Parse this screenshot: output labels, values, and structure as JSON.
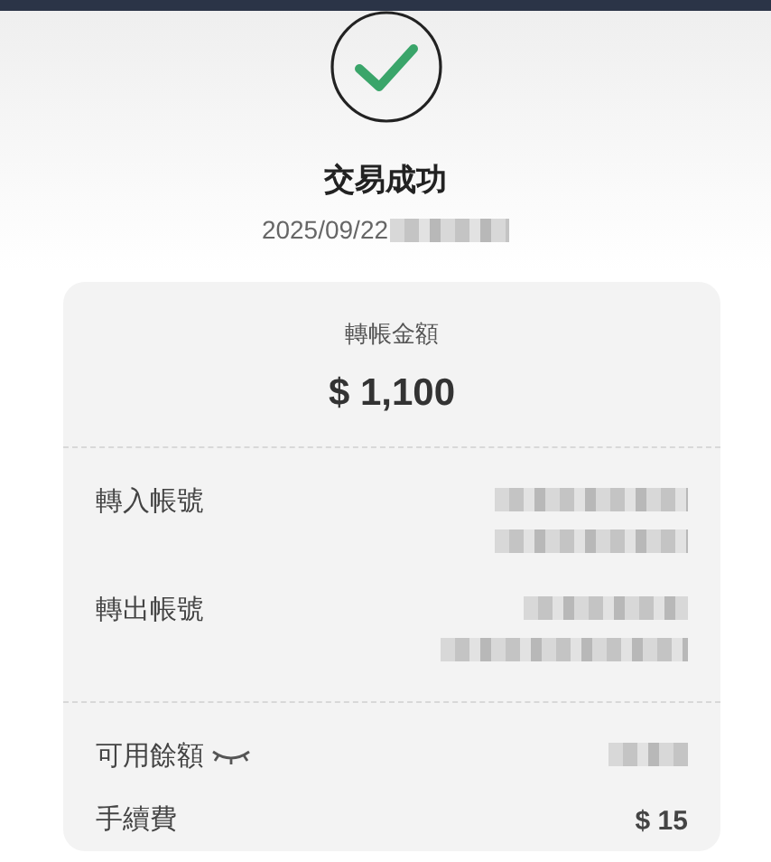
{
  "status": {
    "success": true,
    "title": "交易成功",
    "date": "2025/09/22",
    "date_redacted": true
  },
  "amount": {
    "label": "轉帳金額",
    "value": "$ 1,100"
  },
  "accounts": [
    {
      "label": "轉入帳號",
      "kind": "redacted"
    },
    {
      "label": "轉出帳號",
      "kind": "redacted"
    }
  ],
  "summary": [
    {
      "label": "可用餘額",
      "kind": "redacted",
      "hidden": true
    },
    {
      "label": "手續費",
      "kind": "text",
      "value": "$ 15"
    }
  ]
}
